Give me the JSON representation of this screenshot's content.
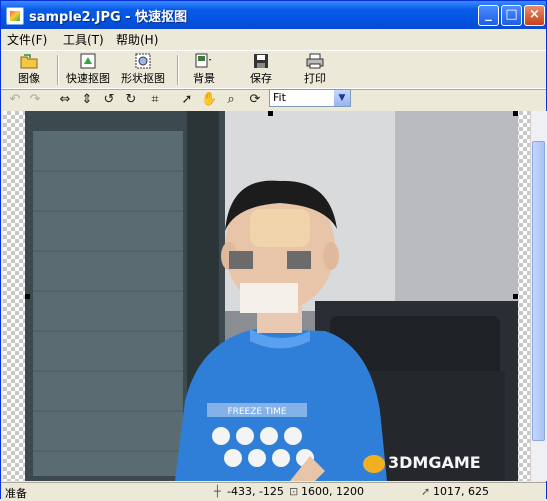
{
  "window": {
    "title": "sample2.JPG - 快速抠图"
  },
  "title_buttons": {
    "minimize": "_",
    "maximize": "□",
    "close": "×"
  },
  "menu": [
    "文件(F)",
    "工具(T)",
    "帮助(H)"
  ],
  "toolbar": {
    "image": "图像",
    "quick_cut": "快速抠图",
    "shape_cut": "形状抠图",
    "background": "背景",
    "save": "保存",
    "print": "打印"
  },
  "zoom": {
    "value": "Fit",
    "arrow": "▼"
  },
  "status": {
    "ready": "准备",
    "cursor": "-433, -125",
    "size": "1600, 1200",
    "pos": "1017, 625"
  },
  "watermark": {
    "text": "3DMGAME"
  },
  "colors": {
    "title_bar": "#0a5ce8",
    "shirt": "#2f7fd8",
    "window_bg": "#ece9d8"
  },
  "shirt_text": "FREEZE TIME"
}
